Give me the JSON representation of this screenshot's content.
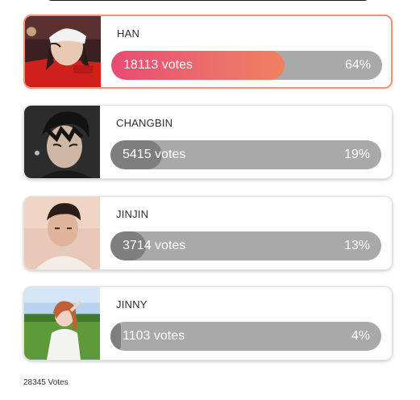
{
  "poll": {
    "total_label": "28345 Votes",
    "accent_gradient": [
      "#e94a73",
      "#f08160"
    ],
    "bar_track_color": "#a9a9a9",
    "bar_fill_color": "#7e7e7e",
    "candidates": [
      {
        "name": "HAN",
        "votes_label": "18113 votes",
        "votes": 18113,
        "percent_label": "64%",
        "percent": 64,
        "leader": true
      },
      {
        "name": "CHANGBIN",
        "votes_label": "5415 votes",
        "votes": 5415,
        "percent_label": "19%",
        "percent": 19,
        "leader": false
      },
      {
        "name": "JINJIN",
        "votes_label": "3714 votes",
        "votes": 3714,
        "percent_label": "13%",
        "percent": 13,
        "leader": false
      },
      {
        "name": "JINNY",
        "votes_label": "1103 votes",
        "votes": 1103,
        "percent_label": "4%",
        "percent": 4,
        "leader": false
      }
    ]
  }
}
